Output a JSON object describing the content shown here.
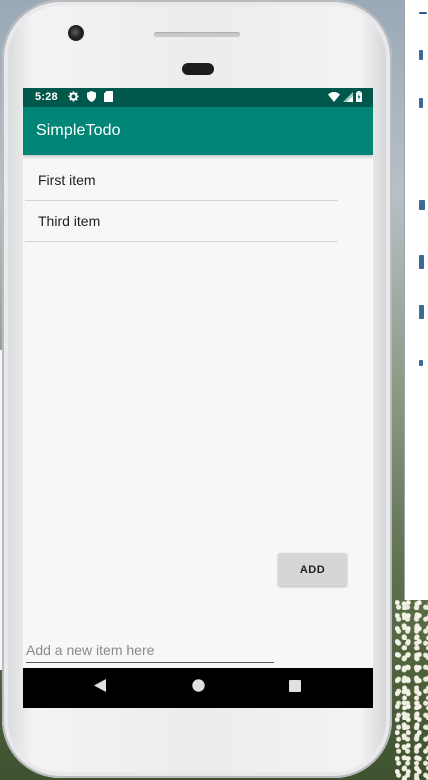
{
  "status_bar": {
    "time": "5:28",
    "left_icons": [
      "gear-icon",
      "shield-icon",
      "sd-card-icon"
    ],
    "right_icons": [
      "wifi-icon",
      "signal-icon",
      "battery-icon"
    ]
  },
  "app": {
    "title": "SimpleTodo",
    "accent_color": "#008577",
    "status_color": "#00574b"
  },
  "todo_list": {
    "items": [
      {
        "text": "First item"
      },
      {
        "text": "Third item"
      }
    ]
  },
  "form": {
    "add_label": "ADD",
    "input_value": "",
    "input_placeholder": "Add a new item here"
  },
  "nav_bar": {
    "buttons": [
      "back-icon",
      "home-icon",
      "recents-icon"
    ]
  }
}
